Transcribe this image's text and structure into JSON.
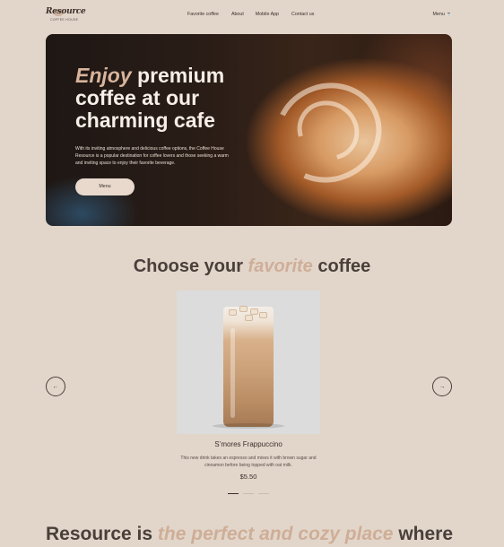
{
  "nav": {
    "logo_text": "Resource",
    "logo_sub": "COFFEE HOUSE",
    "links": [
      "Favorite coffee",
      "About",
      "Mobile App",
      "Contact us"
    ],
    "menu_label": "Menu",
    "menu_icon": "coffee-cup-icon"
  },
  "hero": {
    "title_em": "Enjoy",
    "title_rest_1": "premium",
    "title_line2": "coffee at our",
    "title_line3": "charming cafe",
    "description": "With its inviting atmosphere and delicious coffee options, the Coffee House Resource is a popular destination for coffee lovers and those seeking a warm and inviting space to enjoy their favorite beverage.",
    "button_label": "Menu"
  },
  "favorites": {
    "title_pre": "Choose your",
    "title_em": "favorite",
    "title_post": "coffee",
    "item": {
      "name": "S’mores Frappuccino",
      "description": "This new drink takes an espresso and mixes it with brown sugar and cinnamon before being topped with oat milk.",
      "price": "$5.50"
    },
    "slide_count": 3,
    "active_slide": 1,
    "prev_icon": "arrow-left-icon",
    "next_icon": "arrow-right-icon"
  },
  "about": {
    "title_pre": "Resource is",
    "title_em": "the perfect and cozy place",
    "title_post": "where"
  },
  "colors": {
    "background": "#e2d6cb",
    "text_dark": "#4a3f3a",
    "accent": "#cfae97",
    "button_bg": "#e8d9cc"
  }
}
